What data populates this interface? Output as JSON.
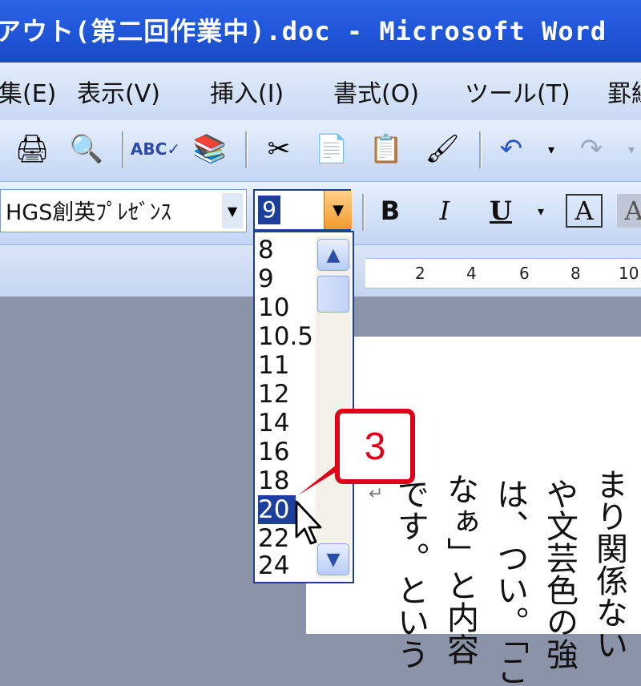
{
  "window": {
    "title": "アウト(第二回作業中).doc - Microsoft Word"
  },
  "menu": {
    "items": [
      "集(E)",
      "表示(V)",
      "挿入(I)",
      "書式(O)",
      "ツール(T)",
      "罫線"
    ]
  },
  "toolbar_standard": {
    "icons": [
      "print-icon",
      "print-preview-icon",
      "spelling-icon",
      "research-icon",
      "cut-icon",
      "copy-icon",
      "paste-icon",
      "format-painter-icon",
      "undo-icon",
      "redo-icon"
    ]
  },
  "toolbar_formatting": {
    "font_name": "HGS創英ﾌﾟﾚｾﾞﾝｽ",
    "font_size": "9",
    "bold_label": "B",
    "italic_label": "I",
    "underline_label": "U",
    "font_color_label": "A"
  },
  "ruler": {
    "ticks": [
      "2",
      "4",
      "6",
      "8",
      "10"
    ]
  },
  "font_size_dropdown": {
    "options": [
      "8",
      "9",
      "10",
      "10.5",
      "11",
      "12",
      "14",
      "16",
      "18",
      "20",
      "22",
      "24"
    ],
    "selected": "20"
  },
  "callout": {
    "number": "3",
    "color": "#e0001a"
  },
  "document": {
    "columns": [
      "まり関係ない",
      "や文芸色の強",
      "は、つい。「こ",
      "なぁ」と内容",
      "です。という"
    ],
    "return_mark": "↵"
  }
}
